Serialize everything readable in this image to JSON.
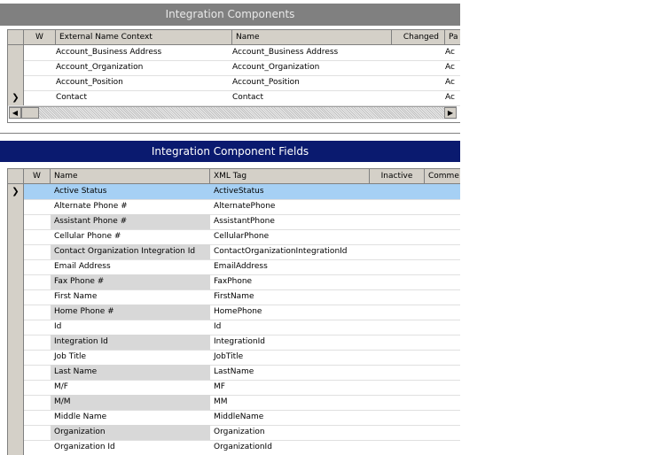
{
  "top_panel": {
    "title": "Integration Components",
    "columns": [
      "W",
      "External Name Context",
      "Name",
      "Changed",
      "Pa"
    ],
    "rows": [
      {
        "selector": "",
        "external": "Account_Business Address",
        "name": "Account_Business Address",
        "pa": "Ac"
      },
      {
        "selector": "",
        "external": "Account_Organization",
        "name": "Account_Organization",
        "pa": "Ac"
      },
      {
        "selector": "",
        "external": "Account_Position",
        "name": "Account_Position",
        "pa": "Ac"
      },
      {
        "selector": "❯",
        "external": "Contact",
        "name": "Contact",
        "pa": "Ac"
      }
    ],
    "scroll_left": "◀",
    "scroll_right": "▶"
  },
  "bottom_panel": {
    "title": "Integration Component Fields",
    "columns": [
      "W",
      "Name",
      "XML Tag",
      "Inactive",
      "Comme"
    ],
    "rows": [
      {
        "selector": "❯",
        "name": "Active Status",
        "xml": "ActiveStatus"
      },
      {
        "selector": "",
        "name": "Alternate Phone #",
        "xml": "AlternatePhone"
      },
      {
        "selector": "",
        "name": "Assistant Phone #",
        "xml": "AssistantPhone"
      },
      {
        "selector": "",
        "name": "Cellular Phone #",
        "xml": "CellularPhone"
      },
      {
        "selector": "",
        "name": "Contact Organization Integration Id",
        "xml": "ContactOrganizationIntegrationId"
      },
      {
        "selector": "",
        "name": "Email Address",
        "xml": "EmailAddress"
      },
      {
        "selector": "",
        "name": "Fax Phone #",
        "xml": "FaxPhone"
      },
      {
        "selector": "",
        "name": "First Name",
        "xml": "FirstName"
      },
      {
        "selector": "",
        "name": "Home Phone #",
        "xml": "HomePhone"
      },
      {
        "selector": "",
        "name": "Id",
        "xml": "Id"
      },
      {
        "selector": "",
        "name": "Integration Id",
        "xml": "IntegrationId"
      },
      {
        "selector": "",
        "name": "Job Title",
        "xml": "JobTitle"
      },
      {
        "selector": "",
        "name": "Last Name",
        "xml": "LastName"
      },
      {
        "selector": "",
        "name": "M/F",
        "xml": "MF"
      },
      {
        "selector": "",
        "name": "M/M",
        "xml": "MM"
      },
      {
        "selector": "",
        "name": "Middle Name",
        "xml": "MiddleName"
      },
      {
        "selector": "",
        "name": "Organization",
        "xml": "Organization"
      },
      {
        "selector": "",
        "name": "Organization Id",
        "xml": "OrganizationId"
      }
    ]
  }
}
